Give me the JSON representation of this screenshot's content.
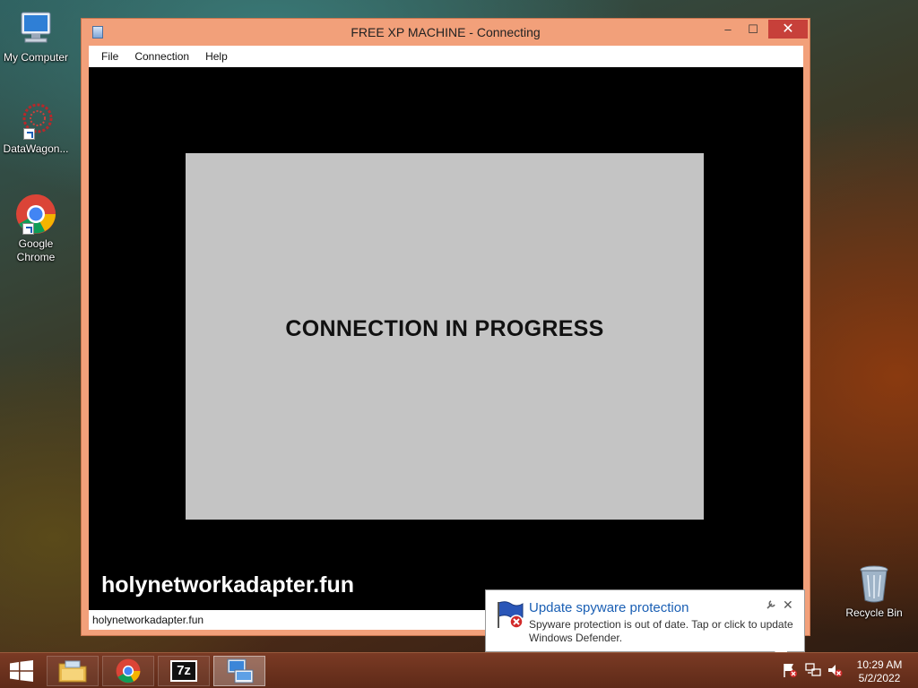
{
  "desktop": {
    "icons": [
      {
        "label": "My Computer"
      },
      {
        "label": "DataWagon..."
      },
      {
        "label": "Google Chrome"
      },
      {
        "label": "Recycle Bin"
      }
    ]
  },
  "window": {
    "title": "FREE XP MACHINE - Connecting",
    "controls": {
      "minimize": "–",
      "maximize": "☐",
      "close": "✕"
    },
    "menu": [
      "File",
      "Connection",
      "Help"
    ],
    "viewport": {
      "message": "CONNECTION IN PROGRESS",
      "watermark": "holynetworkadapter.fun"
    },
    "status": "holynetworkadapter.fun"
  },
  "notification": {
    "title": "Update spyware protection",
    "body": "Spyware protection is out of date. Tap or click to update Windows Defender.",
    "close": "✕"
  },
  "taskbar": {
    "apps": [
      "file-explorer",
      "google-chrome",
      "7-zip",
      "remote-connection"
    ],
    "seven_zip_label": "7z",
    "tray": [
      "action-center-icon",
      "network-icon",
      "volume-muted-icon"
    ],
    "clock": {
      "time": "10:29 AM",
      "date": "5/2/2022"
    }
  },
  "colors": {
    "window_frame": "#f2a07a",
    "close_button": "#c7403a",
    "notification_title": "#1a5fb4",
    "taskbar": "#6a301e"
  }
}
